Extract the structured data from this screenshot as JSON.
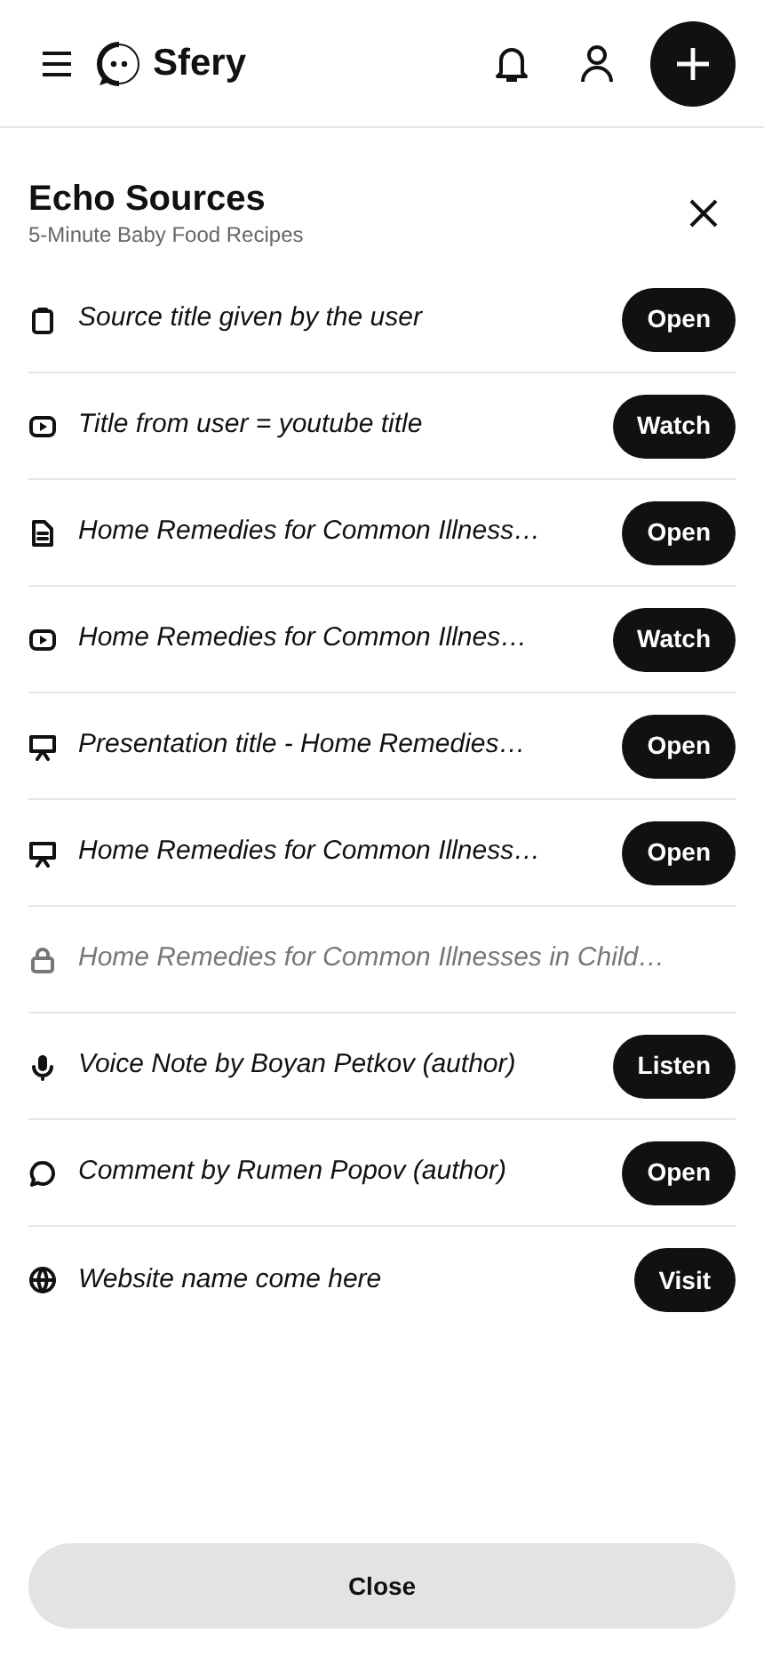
{
  "header": {
    "brand": "Sfery"
  },
  "panel": {
    "title": "Echo Sources",
    "subtitle": "5-Minute Baby Food Recipes"
  },
  "sources": [
    {
      "kind": "clipboard",
      "title": "Source title given by the user",
      "locked": false,
      "action": "Open"
    },
    {
      "kind": "video",
      "title": "Title from user = youtube title",
      "locked": false,
      "action": "Watch"
    },
    {
      "kind": "document",
      "title": "Home Remedies for Common Illness…",
      "locked": false,
      "action": "Open"
    },
    {
      "kind": "video",
      "title": "Home Remedies for Common Illnes…",
      "locked": false,
      "action": "Watch"
    },
    {
      "kind": "presentation",
      "title": "Presentation title - Home Remedies…",
      "locked": false,
      "action": "Open"
    },
    {
      "kind": "presentation",
      "title": "Home Remedies for Common Illness…",
      "locked": false,
      "action": "Open"
    },
    {
      "kind": "lock",
      "title": "Home Remedies for Common Illnesses in Child…",
      "locked": true
    },
    {
      "kind": "mic",
      "title": "Voice Note by Boyan Petkov (author)",
      "locked": false,
      "action": "Listen"
    },
    {
      "kind": "comment",
      "title": "Comment by Rumen Popov (author)",
      "locked": false,
      "action": "Open"
    },
    {
      "kind": "globe",
      "title": "Website name come here",
      "locked": false,
      "action": "Visit"
    }
  ],
  "footer": {
    "close": "Close"
  }
}
